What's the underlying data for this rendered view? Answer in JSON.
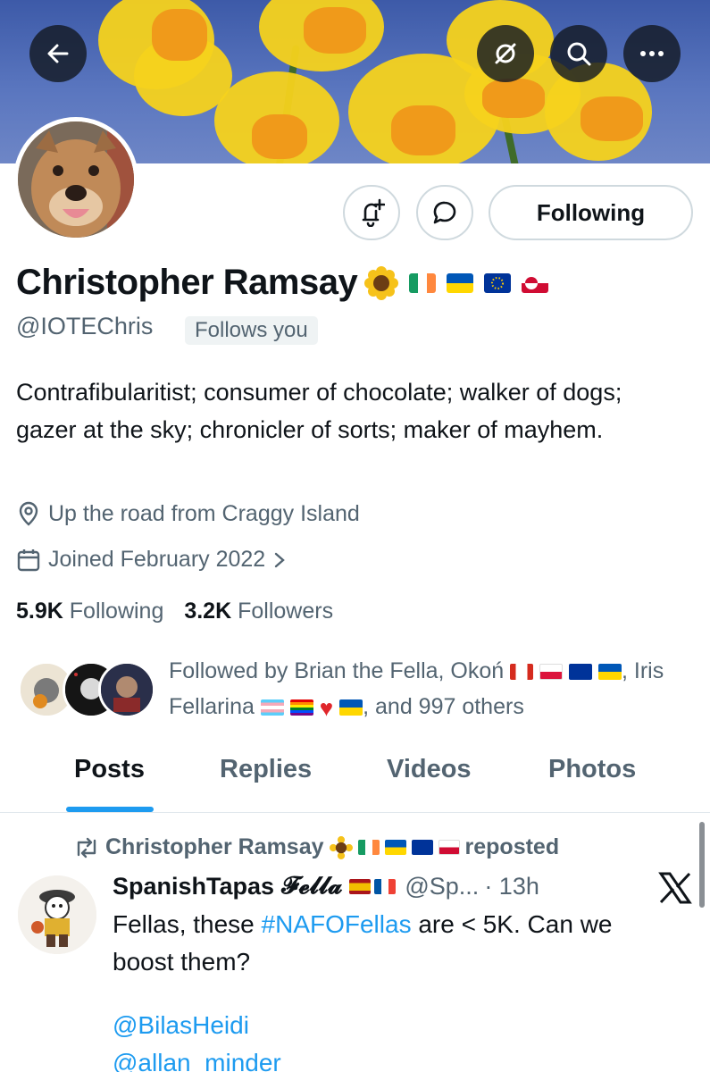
{
  "profile": {
    "name": "Christopher Ramsay",
    "name_emojis": [
      "sunflower",
      "flag-ireland",
      "flag-ukraine",
      "flag-eu",
      "flag-greenland"
    ],
    "handle": "@IOTEChris",
    "follows_you": "Follows you",
    "bio": "Contrafibularitist; consumer of chocolate; walker of dogs; gazer at the sky; chronicler of sorts; maker of mayhem.",
    "location": "Up the road from Craggy Island",
    "joined": "Joined February 2022",
    "following_count": "5.9K",
    "following_label": "Following",
    "followers_count": "3.2K",
    "followers_label": "Followers"
  },
  "header": {
    "icons": [
      "back-arrow-icon",
      "grok-icon",
      "search-icon",
      "more-icon"
    ]
  },
  "actions": {
    "notify_icon": "bell-plus-icon",
    "message_icon": "message-bubble-icon",
    "following_button": "Following"
  },
  "followed_by": {
    "prefix": "Followed by Brian the Fella, Okoń",
    "middle": ", Iris Fellarina",
    "suffix": ", and 997 others"
  },
  "tabs": [
    {
      "label": "Posts",
      "active": true
    },
    {
      "label": "Replies",
      "active": false
    },
    {
      "label": "Videos",
      "active": false
    },
    {
      "label": "Photos",
      "active": false
    }
  ],
  "post": {
    "repost_by": "Christopher Ramsay",
    "repost_label": "reposted",
    "author_name": "SpanishTapas",
    "author_fancy": "𝓕𝓮𝓵𝓵𝓪",
    "author_handle": "@Sp...",
    "time": "· 13h",
    "text_before": "Fellas, these ",
    "hashtag": "#NAFOFellas",
    "text_after": " are < 5K. Can we boost them?",
    "mentions": [
      "@BilasHeidi",
      "@allan_minder"
    ]
  },
  "colors": {
    "accent": "#1d9bf0",
    "text": "#0f1419",
    "secondary": "#536471",
    "border": "#cfd9de"
  }
}
